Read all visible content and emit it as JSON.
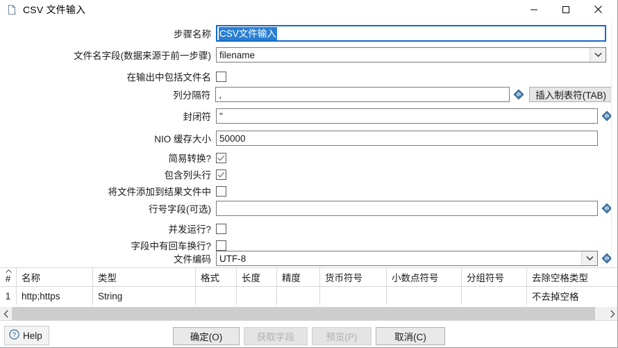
{
  "window": {
    "title": "CSV 文件输入",
    "icon": "file-icon",
    "controls": {
      "minimize": "minimize-icon",
      "maximize": "maximize-icon",
      "close": "close-icon"
    }
  },
  "form": {
    "rows": [
      {
        "label": "步骤名称",
        "type": "text",
        "value": "CSV文件输入",
        "focused": true,
        "selected": true
      },
      {
        "label": "文件名字段(数据来源于前一步骤)",
        "type": "select",
        "value": "filename"
      },
      {
        "label": "在输出中包括文件名",
        "type": "checkbox",
        "checked": false
      },
      {
        "label": "列分隔符",
        "type": "text",
        "value": ",",
        "variable": true,
        "button": "插入制表符(TAB)"
      },
      {
        "label": "封闭符",
        "type": "text",
        "value": "\"",
        "variable": true
      },
      {
        "label": "NIO 缓存大小",
        "type": "text",
        "value": "50000"
      },
      {
        "label": "简易转换?",
        "type": "checkbox",
        "checked": true
      },
      {
        "label": "包含列头行",
        "type": "checkbox",
        "checked": true
      },
      {
        "label": "将文件添加到结果文件中",
        "type": "checkbox",
        "checked": false
      },
      {
        "label": "行号字段(可选)",
        "type": "text",
        "value": "",
        "variable": true
      },
      {
        "label": "并发运行?",
        "type": "checkbox",
        "checked": false
      },
      {
        "label": "字段中有回车换行?",
        "type": "checkbox",
        "checked": false
      },
      {
        "label": "文件编码",
        "type": "select",
        "value": "UTF-8",
        "variable": true
      }
    ],
    "insert_tab_button": "插入制表符(TAB)"
  },
  "fields_table": {
    "columns": [
      "#",
      "名称",
      "类型",
      "格式",
      "长度",
      "精度",
      "货币符号",
      "小数点符号",
      "分组符号",
      "去除空格类型"
    ],
    "rows": [
      {
        "#": "1",
        "名称": "http;https",
        "类型": "String",
        "格式": "",
        "长度": "",
        "精度": "",
        "货币符号": "",
        "小数点符号": "",
        "分组符号": "",
        "去除空格类型": "不去掉空格"
      }
    ]
  },
  "footer": {
    "help": "Help",
    "ok": "确定(O)",
    "get_fields": "获取字段",
    "preview": "预览(P)",
    "cancel": "取消(C)"
  },
  "colors": {
    "selection": "#2a7fd4",
    "focus_border": "#1569c7",
    "variable_icon": "#3a6e9e",
    "disabled_text": "#b0b0b0"
  }
}
